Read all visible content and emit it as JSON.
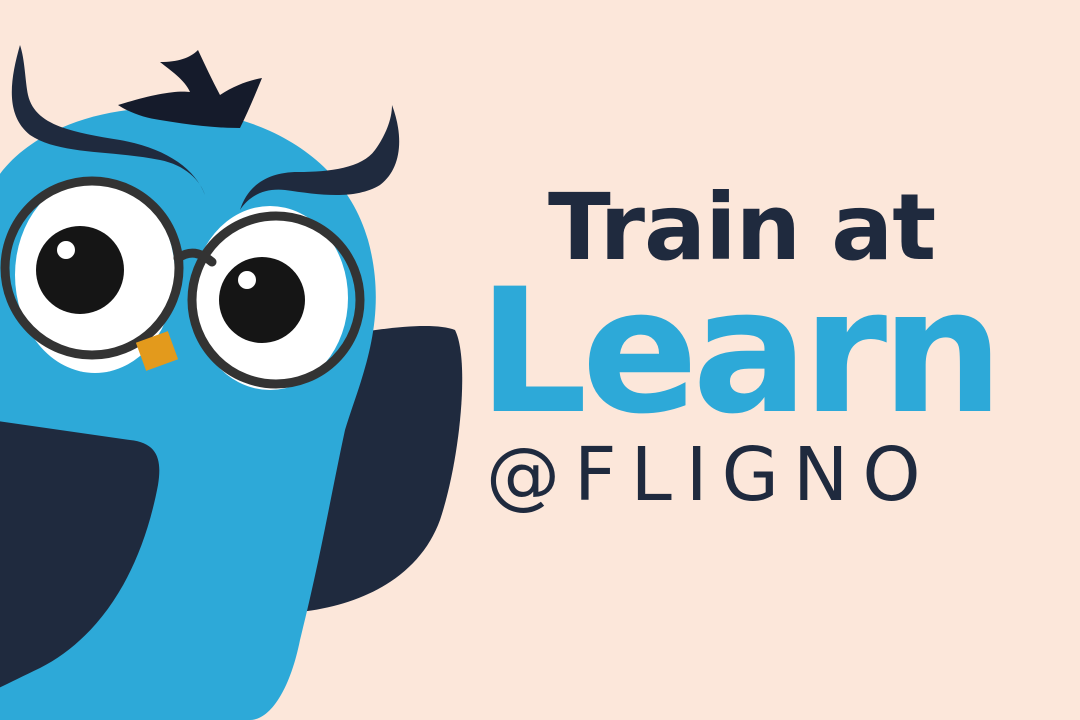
{
  "headline": {
    "line1": "Train at",
    "line2": "Learn",
    "line3": "@FLIGNO"
  },
  "colors": {
    "background": "#FCE7DA",
    "dark_navy": "#1F2A3E",
    "brand_blue": "#2DA9D8",
    "white": "#FFFFFF",
    "glasses": "#333333",
    "beak": "#E39A1C",
    "pupil": "#151515"
  },
  "mascot": {
    "name": "owl-mascot-icon"
  }
}
